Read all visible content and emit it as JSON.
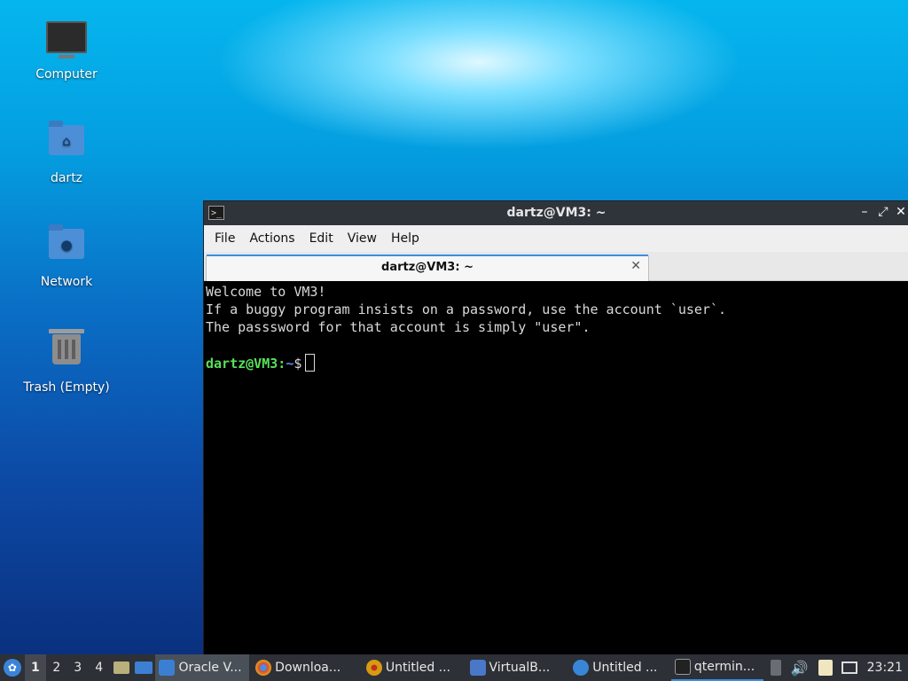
{
  "desktop": {
    "icons": [
      {
        "label": "Computer",
        "icon": "computer-icon"
      },
      {
        "label": "dartz",
        "icon": "home-folder-icon"
      },
      {
        "label": "Network",
        "icon": "network-folder-icon"
      },
      {
        "label": "Trash (Empty)",
        "icon": "trash-icon"
      }
    ]
  },
  "window": {
    "title": "dartz@VM3: ~",
    "controls": {
      "minimize": "–",
      "maximize": "⤢",
      "close": "✕"
    },
    "menu": [
      "File",
      "Actions",
      "Edit",
      "View",
      "Help"
    ],
    "tab": {
      "label": "dartz@VM3: ~",
      "close": "✕"
    },
    "terminal": {
      "lines": [
        "Welcome to VM3!",
        "If a buggy program insists on a password, use the account `user`.",
        "The passsword for that account is simply \"user\"."
      ],
      "prompt_user": "dartz@VM3",
      "prompt_sep": ":",
      "prompt_path": "~",
      "prompt_symbol": "$"
    }
  },
  "taskbar": {
    "workspaces": [
      "1",
      "2",
      "3",
      "4"
    ],
    "tasks": [
      {
        "label": "Oracle V...",
        "icon_color": "#3b7fd4"
      },
      {
        "label": "Downloa...",
        "icon_color": "#e0a020"
      },
      {
        "label": "Untitled ...",
        "icon_color": "#d89a10"
      },
      {
        "label": "VirtualB...",
        "icon_color": "#4a78c8"
      },
      {
        "label": "Untitled ...",
        "icon_color": "#3a86d6"
      },
      {
        "label": "qtermin...",
        "icon_color": "#222222"
      }
    ],
    "clock": "23:21"
  }
}
